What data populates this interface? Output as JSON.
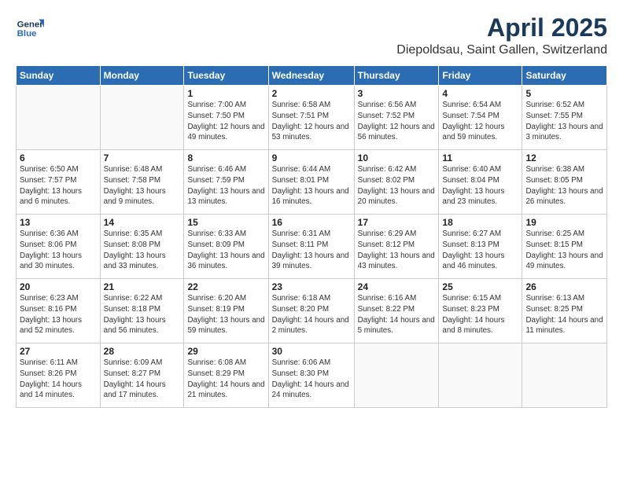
{
  "header": {
    "logo_line1": "General",
    "logo_line2": "Blue",
    "title": "April 2025",
    "subtitle": "Diepoldsau, Saint Gallen, Switzerland"
  },
  "calendar": {
    "weekdays": [
      "Sunday",
      "Monday",
      "Tuesday",
      "Wednesday",
      "Thursday",
      "Friday",
      "Saturday"
    ],
    "weeks": [
      [
        {
          "day": "",
          "sunrise": "",
          "sunset": "",
          "daylight": ""
        },
        {
          "day": "",
          "sunrise": "",
          "sunset": "",
          "daylight": ""
        },
        {
          "day": "1",
          "sunrise": "Sunrise: 7:00 AM",
          "sunset": "Sunset: 7:50 PM",
          "daylight": "Daylight: 12 hours and 49 minutes."
        },
        {
          "day": "2",
          "sunrise": "Sunrise: 6:58 AM",
          "sunset": "Sunset: 7:51 PM",
          "daylight": "Daylight: 12 hours and 53 minutes."
        },
        {
          "day": "3",
          "sunrise": "Sunrise: 6:56 AM",
          "sunset": "Sunset: 7:52 PM",
          "daylight": "Daylight: 12 hours and 56 minutes."
        },
        {
          "day": "4",
          "sunrise": "Sunrise: 6:54 AM",
          "sunset": "Sunset: 7:54 PM",
          "daylight": "Daylight: 12 hours and 59 minutes."
        },
        {
          "day": "5",
          "sunrise": "Sunrise: 6:52 AM",
          "sunset": "Sunset: 7:55 PM",
          "daylight": "Daylight: 13 hours and 3 minutes."
        }
      ],
      [
        {
          "day": "6",
          "sunrise": "Sunrise: 6:50 AM",
          "sunset": "Sunset: 7:57 PM",
          "daylight": "Daylight: 13 hours and 6 minutes."
        },
        {
          "day": "7",
          "sunrise": "Sunrise: 6:48 AM",
          "sunset": "Sunset: 7:58 PM",
          "daylight": "Daylight: 13 hours and 9 minutes."
        },
        {
          "day": "8",
          "sunrise": "Sunrise: 6:46 AM",
          "sunset": "Sunset: 7:59 PM",
          "daylight": "Daylight: 13 hours and 13 minutes."
        },
        {
          "day": "9",
          "sunrise": "Sunrise: 6:44 AM",
          "sunset": "Sunset: 8:01 PM",
          "daylight": "Daylight: 13 hours and 16 minutes."
        },
        {
          "day": "10",
          "sunrise": "Sunrise: 6:42 AM",
          "sunset": "Sunset: 8:02 PM",
          "daylight": "Daylight: 13 hours and 20 minutes."
        },
        {
          "day": "11",
          "sunrise": "Sunrise: 6:40 AM",
          "sunset": "Sunset: 8:04 PM",
          "daylight": "Daylight: 13 hours and 23 minutes."
        },
        {
          "day": "12",
          "sunrise": "Sunrise: 6:38 AM",
          "sunset": "Sunset: 8:05 PM",
          "daylight": "Daylight: 13 hours and 26 minutes."
        }
      ],
      [
        {
          "day": "13",
          "sunrise": "Sunrise: 6:36 AM",
          "sunset": "Sunset: 8:06 PM",
          "daylight": "Daylight: 13 hours and 30 minutes."
        },
        {
          "day": "14",
          "sunrise": "Sunrise: 6:35 AM",
          "sunset": "Sunset: 8:08 PM",
          "daylight": "Daylight: 13 hours and 33 minutes."
        },
        {
          "day": "15",
          "sunrise": "Sunrise: 6:33 AM",
          "sunset": "Sunset: 8:09 PM",
          "daylight": "Daylight: 13 hours and 36 minutes."
        },
        {
          "day": "16",
          "sunrise": "Sunrise: 6:31 AM",
          "sunset": "Sunset: 8:11 PM",
          "daylight": "Daylight: 13 hours and 39 minutes."
        },
        {
          "day": "17",
          "sunrise": "Sunrise: 6:29 AM",
          "sunset": "Sunset: 8:12 PM",
          "daylight": "Daylight: 13 hours and 43 minutes."
        },
        {
          "day": "18",
          "sunrise": "Sunrise: 6:27 AM",
          "sunset": "Sunset: 8:13 PM",
          "daylight": "Daylight: 13 hours and 46 minutes."
        },
        {
          "day": "19",
          "sunrise": "Sunrise: 6:25 AM",
          "sunset": "Sunset: 8:15 PM",
          "daylight": "Daylight: 13 hours and 49 minutes."
        }
      ],
      [
        {
          "day": "20",
          "sunrise": "Sunrise: 6:23 AM",
          "sunset": "Sunset: 8:16 PM",
          "daylight": "Daylight: 13 hours and 52 minutes."
        },
        {
          "day": "21",
          "sunrise": "Sunrise: 6:22 AM",
          "sunset": "Sunset: 8:18 PM",
          "daylight": "Daylight: 13 hours and 56 minutes."
        },
        {
          "day": "22",
          "sunrise": "Sunrise: 6:20 AM",
          "sunset": "Sunset: 8:19 PM",
          "daylight": "Daylight: 13 hours and 59 minutes."
        },
        {
          "day": "23",
          "sunrise": "Sunrise: 6:18 AM",
          "sunset": "Sunset: 8:20 PM",
          "daylight": "Daylight: 14 hours and 2 minutes."
        },
        {
          "day": "24",
          "sunrise": "Sunrise: 6:16 AM",
          "sunset": "Sunset: 8:22 PM",
          "daylight": "Daylight: 14 hours and 5 minutes."
        },
        {
          "day": "25",
          "sunrise": "Sunrise: 6:15 AM",
          "sunset": "Sunset: 8:23 PM",
          "daylight": "Daylight: 14 hours and 8 minutes."
        },
        {
          "day": "26",
          "sunrise": "Sunrise: 6:13 AM",
          "sunset": "Sunset: 8:25 PM",
          "daylight": "Daylight: 14 hours and 11 minutes."
        }
      ],
      [
        {
          "day": "27",
          "sunrise": "Sunrise: 6:11 AM",
          "sunset": "Sunset: 8:26 PM",
          "daylight": "Daylight: 14 hours and 14 minutes."
        },
        {
          "day": "28",
          "sunrise": "Sunrise: 6:09 AM",
          "sunset": "Sunset: 8:27 PM",
          "daylight": "Daylight: 14 hours and 17 minutes."
        },
        {
          "day": "29",
          "sunrise": "Sunrise: 6:08 AM",
          "sunset": "Sunset: 8:29 PM",
          "daylight": "Daylight: 14 hours and 21 minutes."
        },
        {
          "day": "30",
          "sunrise": "Sunrise: 6:06 AM",
          "sunset": "Sunset: 8:30 PM",
          "daylight": "Daylight: 14 hours and 24 minutes."
        },
        {
          "day": "",
          "sunrise": "",
          "sunset": "",
          "daylight": ""
        },
        {
          "day": "",
          "sunrise": "",
          "sunset": "",
          "daylight": ""
        },
        {
          "day": "",
          "sunrise": "",
          "sunset": "",
          "daylight": ""
        }
      ]
    ]
  }
}
